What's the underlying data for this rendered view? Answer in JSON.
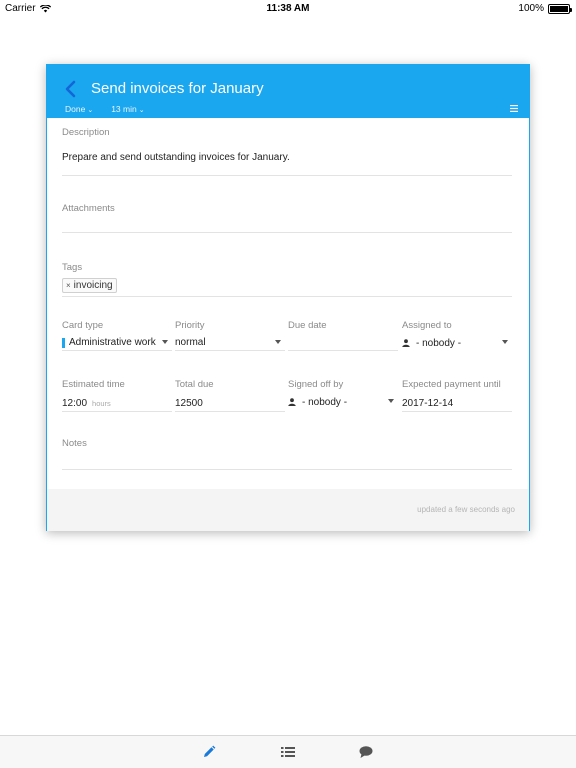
{
  "status_bar": {
    "carrier": "Carrier",
    "time": "11:38 AM",
    "battery": "100%"
  },
  "card": {
    "title": "Send invoices for January",
    "status": "Done",
    "duration": "13 min",
    "accent_color": "#1aa7f0",
    "description": {
      "label": "Description",
      "value": "Prepare and send outstanding invoices for January."
    },
    "attachments": {
      "label": "Attachments"
    },
    "tags": {
      "label": "Tags",
      "items": [
        {
          "remove": "×",
          "name": "invoicing"
        }
      ]
    },
    "fields_row1": {
      "card_type": {
        "label": "Card type",
        "value": "Administrative work"
      },
      "priority": {
        "label": "Priority",
        "value": "normal"
      },
      "due_date": {
        "label": "Due date",
        "value": ""
      },
      "assigned_to": {
        "label": "Assigned to",
        "value": "- nobody -"
      }
    },
    "fields_row2": {
      "estimated_time": {
        "label": "Estimated time",
        "value": "12:00",
        "unit": "hours"
      },
      "total_due": {
        "label": "Total due",
        "value": "12500"
      },
      "signed_off_by": {
        "label": "Signed off by",
        "value": "- nobody -"
      },
      "expected_payment": {
        "label": "Expected payment until",
        "value": "2017-12-14"
      }
    },
    "notes": {
      "label": "Notes"
    },
    "footer": {
      "updated": "updated a few seconds ago"
    }
  },
  "tabbar": {
    "tabs": [
      {
        "icon": "pencil-icon",
        "active": true,
        "color": "#1a7ad9"
      },
      {
        "icon": "list-icon",
        "active": false,
        "color": "#555555"
      },
      {
        "icon": "chat-icon",
        "active": false,
        "color": "#555555"
      }
    ]
  }
}
